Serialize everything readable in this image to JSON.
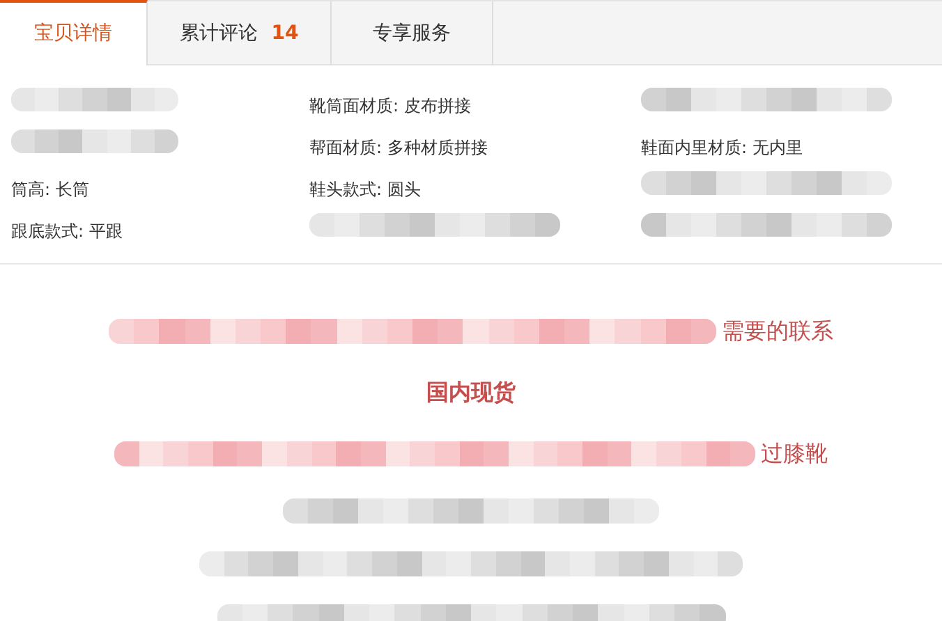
{
  "tabs": [
    {
      "label": "宝贝详情",
      "selected": true
    },
    {
      "label": "累计评论",
      "count": "14",
      "selected": false
    },
    {
      "label": "专享服务",
      "selected": false
    }
  ],
  "attributes": [
    {
      "kind": "blur"
    },
    {
      "kind": "text",
      "text": "靴筒面材质: 皮布拼接"
    },
    {
      "kind": "blur"
    },
    {
      "kind": "blur"
    },
    {
      "kind": "text",
      "text": "帮面材质: 多种材质拼接"
    },
    {
      "kind": "text",
      "text": "鞋面内里材质: 无内里"
    },
    {
      "kind": "text",
      "text": "筒高: 长筒"
    },
    {
      "kind": "text",
      "text": "鞋头款式: 圆头"
    },
    {
      "kind": "blur"
    },
    {
      "kind": "text",
      "text": "跟底款式: 平跟"
    },
    {
      "kind": "blur"
    },
    {
      "kind": "blur"
    }
  ],
  "description": [
    {
      "kind": "blurred_line",
      "text": "需要的联系"
    },
    {
      "kind": "heading",
      "text": "国内现货"
    },
    {
      "kind": "blurred_line",
      "text": "过膝靴"
    },
    {
      "kind": "grey_blur"
    },
    {
      "kind": "grey_blur"
    },
    {
      "kind": "grey_blur"
    }
  ]
}
